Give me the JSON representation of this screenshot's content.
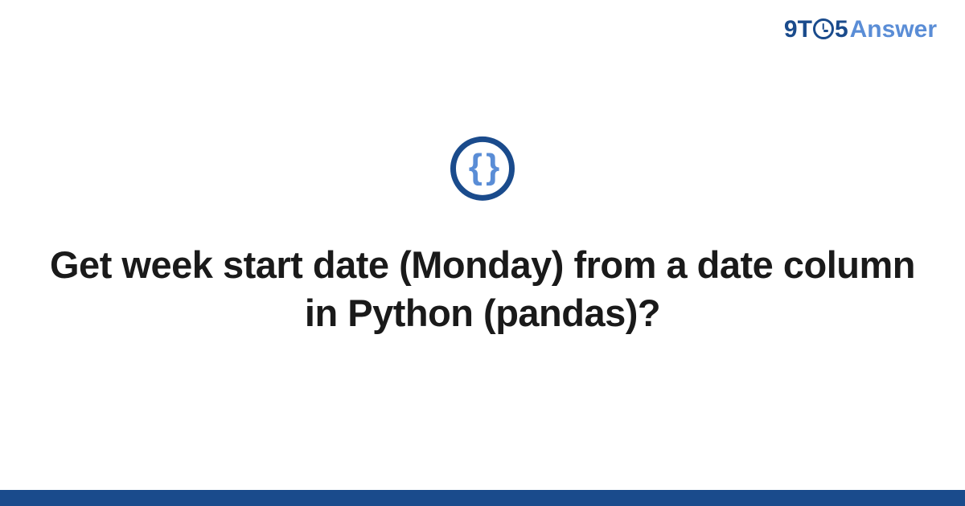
{
  "brand": {
    "part1": "9T",
    "part2": "5",
    "part3": "Answer"
  },
  "icon": {
    "glyph": "{ }"
  },
  "question": {
    "title": "Get week start date (Monday) from a date column in Python (pandas)?"
  }
}
